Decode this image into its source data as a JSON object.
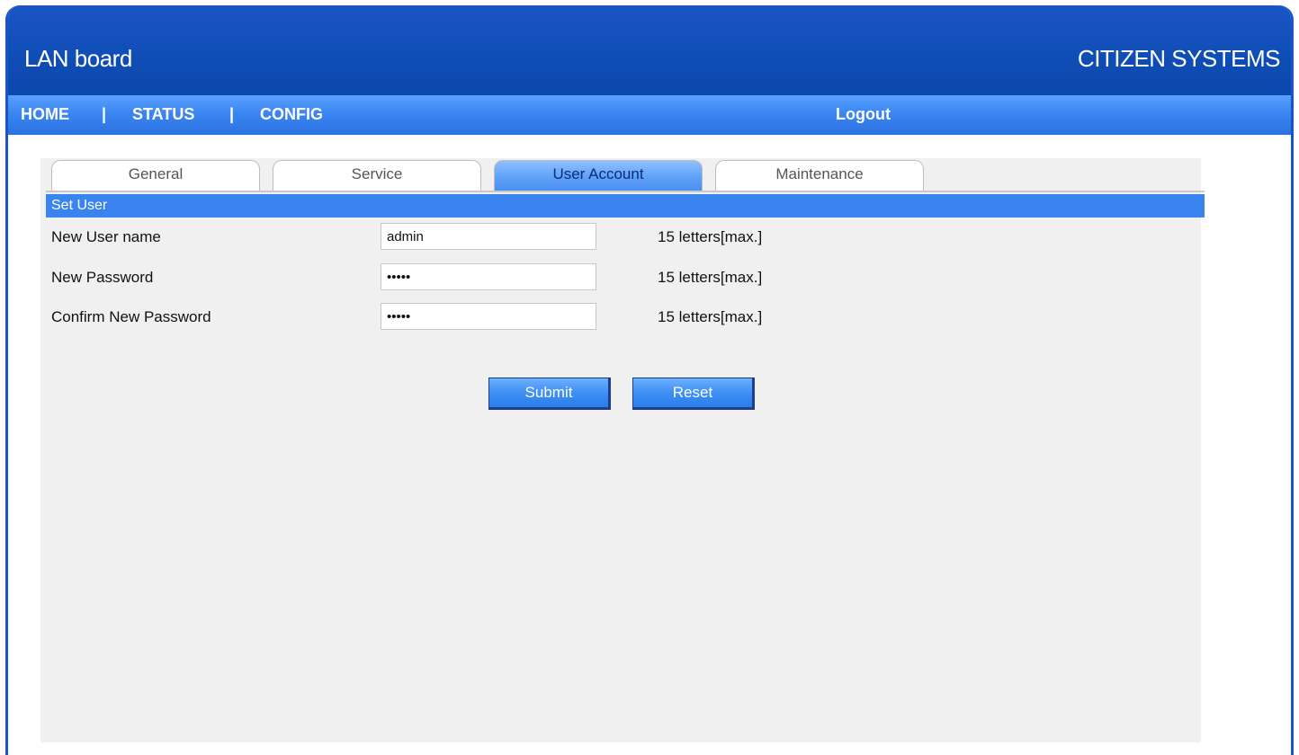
{
  "header": {
    "app_title": "LAN board",
    "brand": "CITIZEN SYSTEMS"
  },
  "nav": {
    "home": "HOME",
    "separator": "|",
    "status": "STATUS",
    "config": "CONFIG",
    "logout": "Logout"
  },
  "tabs": [
    {
      "label": "General",
      "active": false
    },
    {
      "label": "Service",
      "active": false
    },
    {
      "label": "User Account",
      "active": true
    },
    {
      "label": "Maintenance",
      "active": false
    }
  ],
  "section": {
    "title": "Set User"
  },
  "form": {
    "rows": [
      {
        "label": "New User name",
        "value": "admin",
        "type": "text",
        "hint": "15 letters[max.]"
      },
      {
        "label": "New Password",
        "value": "•••••",
        "type": "password",
        "hint": "15 letters[max.]"
      },
      {
        "label": "Confirm New Password",
        "value": "•••••",
        "type": "password",
        "hint": "15 letters[max.]"
      }
    ],
    "submit_label": "Submit",
    "reset_label": "Reset"
  },
  "colors": {
    "header_blue": "#0f4db6",
    "nav_blue": "#3b86f2",
    "section_bar": "#3a84f0",
    "panel_bg": "#f0f0f0"
  }
}
